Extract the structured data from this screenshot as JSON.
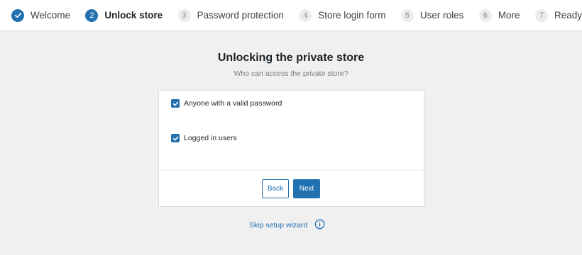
{
  "stepper": {
    "steps": [
      {
        "number": "",
        "label": "Welcome",
        "state": "done"
      },
      {
        "number": "2",
        "label": "Unlock store",
        "state": "current"
      },
      {
        "number": "3",
        "label": "Password protection",
        "state": "pending"
      },
      {
        "number": "4",
        "label": "Store login form",
        "state": "pending"
      },
      {
        "number": "5",
        "label": "User roles",
        "state": "pending"
      },
      {
        "number": "6",
        "label": "More",
        "state": "pending"
      },
      {
        "number": "7",
        "label": "Ready",
        "state": "pending"
      }
    ]
  },
  "main": {
    "title": "Unlocking the private store",
    "subtitle": "Who can access the private store?",
    "options": [
      {
        "label": "Anyone with a valid password",
        "checked": true
      },
      {
        "label": "Logged in users",
        "checked": true
      }
    ],
    "back_label": "Back",
    "next_label": "Next",
    "skip_label": "Skip setup wizard"
  },
  "colors": {
    "accent": "#2271b1",
    "background": "#f0f0f1"
  },
  "icons": {
    "done_step": "checkmark-icon",
    "option_check": "checkbox-checked-icon",
    "skip_info": "info-icon"
  }
}
